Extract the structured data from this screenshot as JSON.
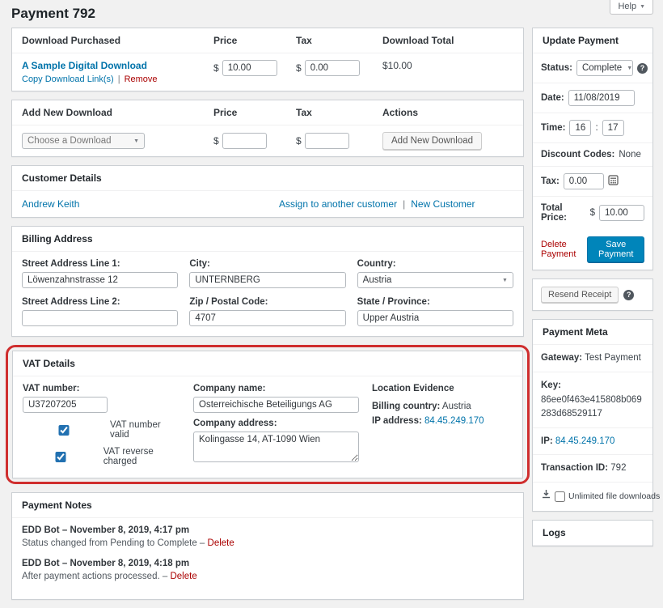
{
  "page": {
    "title": "Payment 792",
    "help_label": "Help"
  },
  "sep": {
    "pipe": "|",
    "dash": "–"
  },
  "downloads": {
    "headers": [
      "Download Purchased",
      "Price",
      "Tax",
      "Download Total"
    ],
    "currency": "$",
    "item": {
      "name": "A Sample Digital Download",
      "copy_label": "Copy Download Link(s)",
      "remove_label": "Remove",
      "price": "10.00",
      "tax": "0.00",
      "total": "$10.00"
    }
  },
  "add_download": {
    "headers": [
      "Add New Download",
      "Price",
      "Tax",
      "Actions"
    ],
    "currency": "$",
    "select_value": "Choose a Download",
    "price": "",
    "tax": "",
    "button_label": "Add New Download"
  },
  "customer": {
    "title": "Customer Details",
    "name": "Andrew Keith",
    "assign_label": "Assign to another customer",
    "new_label": "New Customer"
  },
  "billing": {
    "title": "Billing Address",
    "street1_label": "Street Address Line 1:",
    "street1": "Löwenzahnstrasse 12",
    "street2_label": "Street Address Line 2:",
    "street2": "",
    "city_label": "City:",
    "city": "UNTERNBERG",
    "zip_label": "Zip / Postal Code:",
    "zip": "4707",
    "country_label": "Country:",
    "country": "Austria",
    "state_label": "State / Province:",
    "state": "Upper Austria"
  },
  "vat": {
    "title": "VAT Details",
    "number_label": "VAT number:",
    "number": "U37207205",
    "valid_label": "VAT number valid",
    "reverse_label": "VAT reverse charged",
    "company_name_label": "Company name:",
    "company_name": "Österreichische Beteiligungs AG",
    "company_address_label": "Company address:",
    "company_address": "Kolingasse 14, AT-1090 Wien",
    "evidence_title": "Location Evidence",
    "billing_country_label": "Billing country:",
    "billing_country": "Austria",
    "ip_label": "IP address:",
    "ip": "84.45.249.170"
  },
  "notes": {
    "title": "Payment Notes",
    "items": [
      {
        "author": "EDD Bot",
        "date": "November 8, 2019, 4:17 pm",
        "text": "Status changed from Pending to Complete",
        "delete_label": "Delete"
      },
      {
        "author": "EDD Bot",
        "date": "November 8, 2019, 4:18 pm",
        "text": "After payment actions processed.",
        "delete_label": "Delete"
      }
    ]
  },
  "update": {
    "title": "Update Payment",
    "status_label": "Status:",
    "status": "Complete",
    "date_label": "Date:",
    "date": "11/08/2019",
    "time_label": "Time:",
    "hour": "16",
    "colon": ":",
    "minute": "17",
    "discount_label": "Discount Codes:",
    "discount": "None",
    "tax_label": "Tax:",
    "tax": "0.00",
    "total_label": "Total Price:",
    "currency": "$",
    "total": "10.00",
    "delete_label": "Delete Payment",
    "save_label": "Save Payment",
    "resend_label": "Resend Receipt"
  },
  "meta": {
    "title": "Payment Meta",
    "gateway_label": "Gateway:",
    "gateway": "Test Payment",
    "key_label": "Key:",
    "key": "86ee0f463e415808b069283d68529117",
    "ip_label": "IP:",
    "ip": "84.45.249.170",
    "txn_label": "Transaction ID:",
    "txn": "792",
    "unlimited_label": "Unlimited file downloads"
  },
  "logs": {
    "title": "Logs"
  }
}
